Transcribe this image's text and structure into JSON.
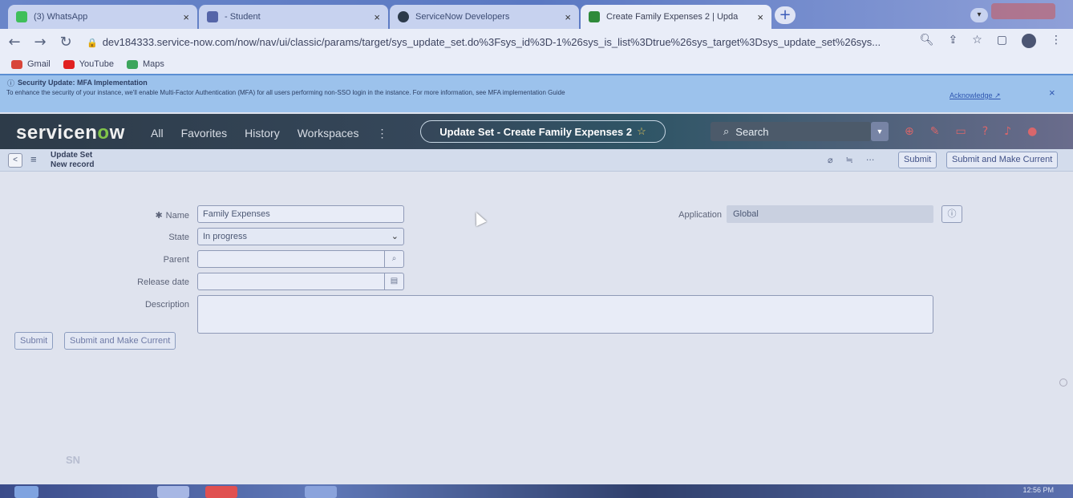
{
  "browser": {
    "tabs": [
      {
        "label": "(3) WhatsApp",
        "color": "#3fbf5a"
      },
      {
        "label": "- Student",
        "color": "#5565a8"
      },
      {
        "label": "ServiceNow Developers",
        "color": "#2c3a4a"
      },
      {
        "label": "Create Family Expenses 2 | Upda",
        "color": "#2f8a3a"
      }
    ],
    "new_tab_symbol": "+",
    "url": "dev184333.service-now.com/now/nav/ui/classic/params/target/sys_update_set.do%3Fsys_id%3D-1%26sys_is_list%3Dtrue%26sys_target%3Dsys_update_set%26sys...",
    "bookmarks": [
      {
        "label": "Gmail",
        "color": "#d8453a"
      },
      {
        "label": "YouTube",
        "color": "#e02020"
      },
      {
        "label": "Maps",
        "color": "#3ca55c"
      }
    ]
  },
  "banner": {
    "title": "Security Update: MFA Implementation",
    "text": "To enhance the security of your instance, we'll enable Multi-Factor Authentication (MFA) for all users performing non-SSO login in the instance. For more information, see MFA implementation Guide",
    "acknowledge": "Acknowledge ↗"
  },
  "header": {
    "logo_pre": "servicen",
    "logo_o": "o",
    "logo_post": "w",
    "nav": [
      "All",
      "Favorites",
      "History",
      "Workspaces"
    ],
    "nav_more": "⋮",
    "context_title": "Update Set - Create Family Expenses 2",
    "search_placeholder": "Search"
  },
  "form_header": {
    "title": "Update Set",
    "subtitle": "New record",
    "submit": "Submit",
    "submit_make_current": "Submit and Make Current"
  },
  "form": {
    "name_label": "Name",
    "name_value": "Family Expenses",
    "state_label": "State",
    "state_value": "In progress",
    "parent_label": "Parent",
    "release_label": "Release date",
    "description_label": "Description",
    "application_label": "Application",
    "application_value": "Global",
    "submit": "Submit",
    "submit_make_current": "Submit and Make Current"
  },
  "footer": {
    "watermark": "SN",
    "clock": "12:56 PM"
  }
}
